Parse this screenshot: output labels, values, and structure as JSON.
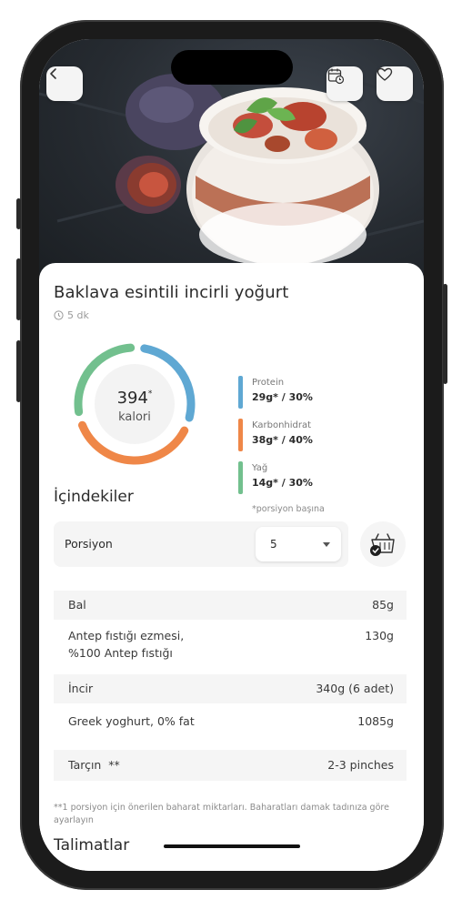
{
  "recipe": {
    "title": "Baklava esintili incirli yoğurt",
    "time": "5 dk"
  },
  "nutrition": {
    "calories_value": "394",
    "calories_mark": "*",
    "calories_label": "kalori",
    "macros": [
      {
        "name": "Protein",
        "value": "29g* / 30%",
        "color": "#5fa8d3",
        "share": 0.3
      },
      {
        "name": "Karbonhidrat",
        "value": "38g* / 40%",
        "color": "#ef8748",
        "share": 0.4
      },
      {
        "name": "Yağ",
        "value": "14g* / 30%",
        "color": "#72c08e",
        "share": 0.3
      }
    ],
    "note": "*porsiyon başına"
  },
  "ingredients": {
    "heading": "İçindekiler",
    "portion_label": "Porsiyon",
    "portion_value": "5",
    "items": [
      {
        "name": "Bal",
        "amount": "85g"
      },
      {
        "name": "Antep fıstığı ezmesi,",
        "name2": "%100 Antep fıstığı",
        "amount": "130g"
      },
      {
        "name": "İncir",
        "amount": "340g (6 adet)"
      },
      {
        "name": "Greek yoghurt, 0% fat",
        "amount": "1085g"
      },
      {
        "name": "Tarçın  **",
        "amount": "2-3 pinches"
      }
    ],
    "footnote": "**1 porsiyon için önerilen baharat miktarları. Baharatları damak tadınıza göre ayarlayın"
  },
  "instructions": {
    "heading": "Talimatlar"
  },
  "icons": {
    "back": "chevron-left-icon",
    "calendar": "calendar-clock-icon",
    "favorite": "heart-icon",
    "clock": "clock-icon",
    "basket": "basket-check-icon",
    "dropdown": "caret-down-icon"
  }
}
